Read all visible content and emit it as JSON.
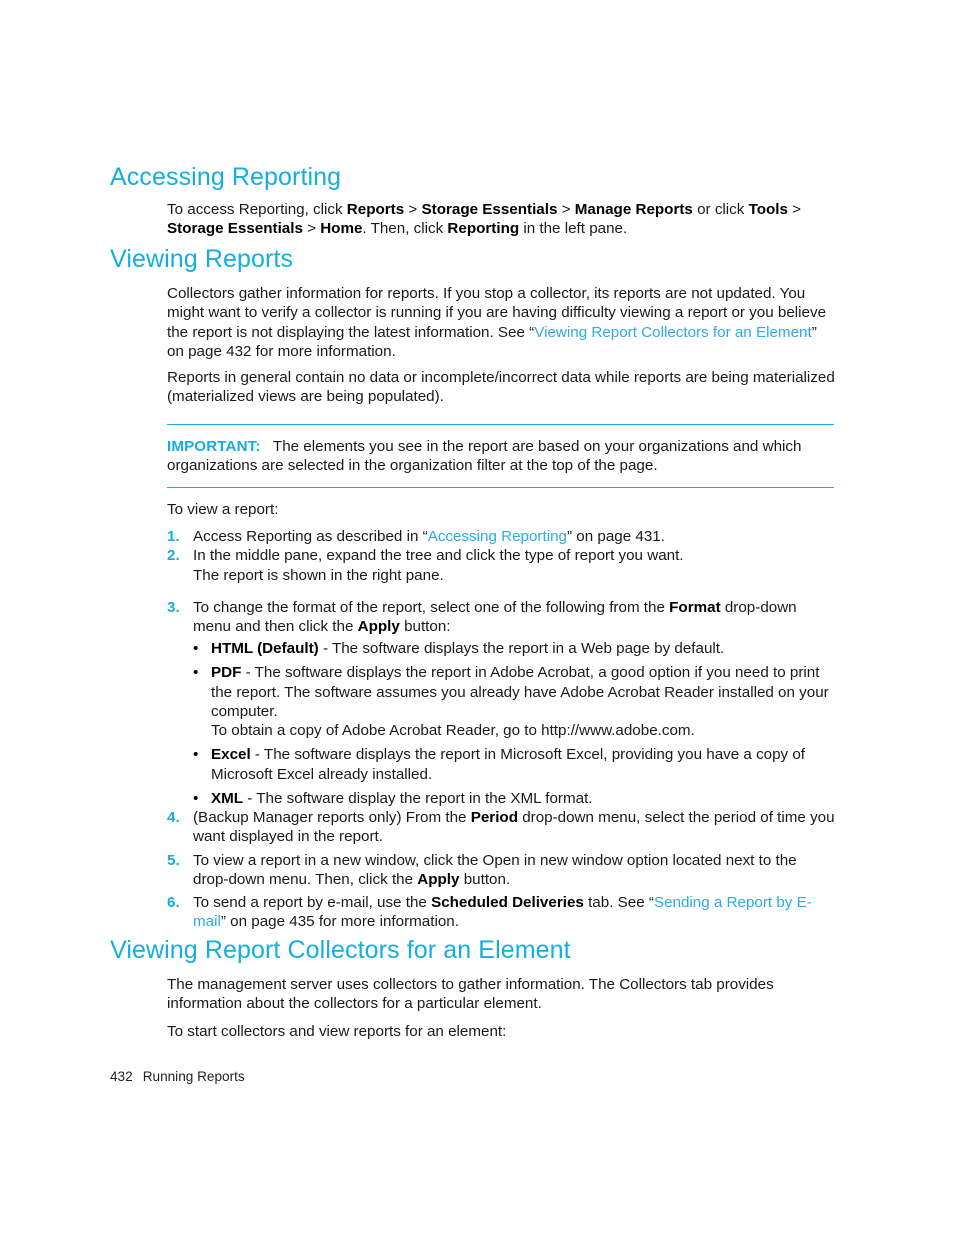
{
  "colors": {
    "heading": "#14AEE0",
    "link": "#2BACE2",
    "body": "#1a1a1a",
    "rule": "#14AEE0"
  },
  "sections": {
    "accessing": {
      "heading": "Accessing Reporting",
      "para_1_a": "To access Reporting, click ",
      "para_1_b1": "Reports",
      "para_1_c": " > ",
      "para_1_b2": "Storage Essentials",
      "para_1_d": " > ",
      "para_1_b3": "Manage Reports",
      "para_1_e": " or click ",
      "para_1_b4": "Tools",
      "para_1_f": " > ",
      "para_1_b5": "Storage Essentials",
      "para_1_g": " > ",
      "para_1_b6": "Home",
      "para_1_h": ". Then, click ",
      "para_1_b7": "Reporting",
      "para_1_i": " in the left pane."
    },
    "viewing_reports": {
      "heading": "Viewing Reports",
      "para_1_a": "Collectors gather information for reports. If you stop a collector, its reports are not updated. You might want to verify a collector is running if you are having difficulty viewing a report or you believe the report is not displaying the latest information. See “",
      "para_1_link": "Viewing Report Collectors for an Element",
      "para_1_b": "” on page 432 for more information.",
      "para_2": "Reports in general contain no data or incomplete/incorrect data while reports are being materialized (materialized views are being populated).",
      "note_label": "IMPORTANT:",
      "note_text": "The elements you see in the report are based on your organizations and which organizations are selected in the organization filter at the top of the page.",
      "intro": "To view a report:",
      "steps": [
        {
          "num": "1.",
          "text_a": "Access Reporting as described in “",
          "link": "Accessing Reporting",
          "text_b": "” on page 431."
        },
        {
          "num": "2.",
          "text_a": "In the middle pane, expand the tree and click the type of report you want.",
          "sub": "The report is shown in the right pane."
        },
        {
          "num": "3.",
          "text_a": "To change the format of the report, select one of the following from the ",
          "bold_1": "Format",
          "text_b": " drop-down menu and then click the ",
          "bold_2": "Apply",
          "text_c": " button:",
          "bullets": [
            {
              "bold": "HTML (Default)",
              "text": " - The software displays the report in a Web page by default."
            },
            {
              "bold": "PDF",
              "text": " - The software displays the report in Adobe Acrobat, a good option if you need to print the report. The software assumes you already have Adobe Acrobat Reader installed on your computer.",
              "extra": "To obtain a copy of Adobe Acrobat Reader, go to http://www.adobe.com."
            },
            {
              "bold": "Excel",
              "text": " - The software displays the report in Microsoft Excel, providing you have a copy of Microsoft Excel already installed."
            },
            {
              "bold": "XML",
              "text": " - The software display the report in the XML format."
            }
          ]
        },
        {
          "num": "4.",
          "text_a": "(Backup Manager reports only) From the ",
          "bold_1": "Period",
          "text_b": " drop-down menu, select the period of time you want displayed in the report."
        },
        {
          "num": "5.",
          "text_a": "To view a report in a new window, click the Open in new window option located next to the drop-down menu. Then, click the ",
          "bold_1": "Apply",
          "text_b": " button."
        },
        {
          "num": "6.",
          "text_a": "To send a report by e-mail, use the ",
          "bold_1": "Scheduled Deliveries",
          "text_b": " tab. See “",
          "link": "Sending a Report by E-mail",
          "text_c": "” on page 435 for more information."
        }
      ]
    },
    "viewing_collectors": {
      "heading": "Viewing Report Collectors for an Element",
      "para_1": "The management server uses collectors to gather information. The Collectors tab provides information about the collectors for a particular element.",
      "para_2": "To start collectors and view reports for an element:"
    }
  },
  "footer": {
    "page_number": "432",
    "chapter": "Running Reports"
  }
}
